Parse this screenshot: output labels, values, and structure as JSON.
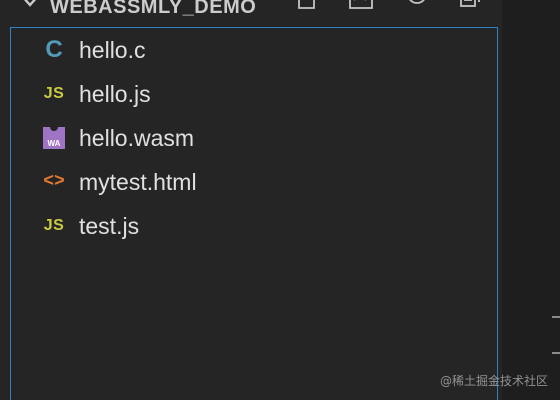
{
  "explorer": {
    "folder_name": "WEBASSMLY_DEMO",
    "files": [
      {
        "name": "hello.c",
        "icon": "c-file-icon",
        "glyph": "C",
        "color": "#519aba"
      },
      {
        "name": "hello.js",
        "icon": "js-file-icon",
        "glyph": "JS",
        "color": "#cbcb41"
      },
      {
        "name": "hello.wasm",
        "icon": "wasm-file-icon",
        "glyph": "WA",
        "color": "#a074c4"
      },
      {
        "name": "mytest.html",
        "icon": "html-file-icon",
        "glyph": "<>",
        "color": "#e37933"
      },
      {
        "name": "test.js",
        "icon": "js-file-icon",
        "glyph": "JS",
        "color": "#cbcb41"
      }
    ],
    "actions": [
      "new-file-icon",
      "new-folder-icon",
      "refresh-icon",
      "collapse-all-icon"
    ]
  },
  "watermark": "@稀土掘金技术社区",
  "colors": {
    "background": "#252526",
    "focus_border": "#2f81c4",
    "text": "#e0e0e0"
  }
}
